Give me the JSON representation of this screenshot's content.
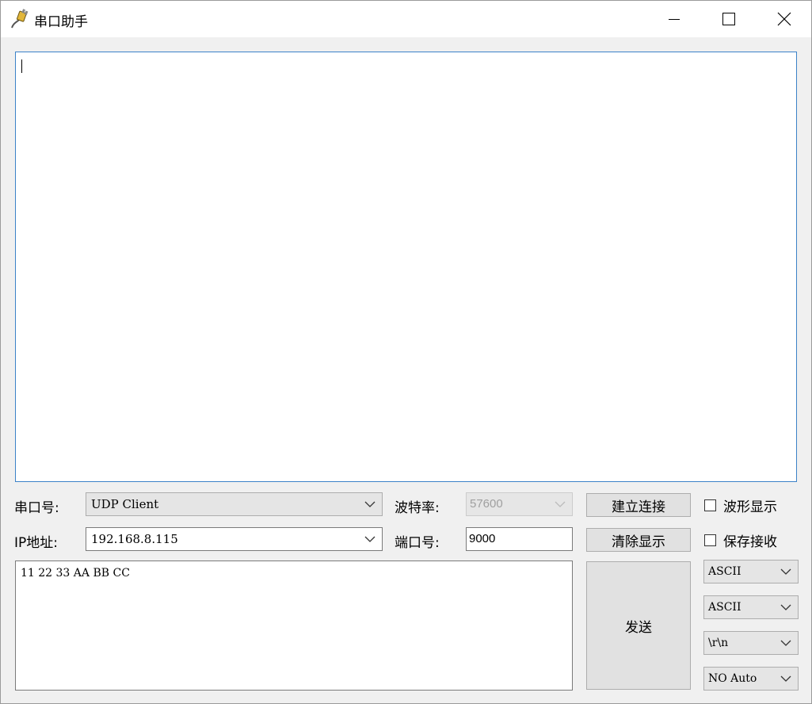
{
  "window": {
    "title": "串口助手"
  },
  "receive": {
    "content": ""
  },
  "settings": {
    "port_label": "串口号:",
    "port_value": "UDP Client",
    "baud_label": "波特率:",
    "baud_value": "57600",
    "ip_label": "IP地址:",
    "ip_value": "192.168.8.115",
    "netport_label": "端口号:",
    "netport_value": "9000"
  },
  "buttons": {
    "connect": "建立连接",
    "clear": "清除显示",
    "send": "发送"
  },
  "checkboxes": {
    "waveform": {
      "label": "波形显示",
      "checked": false
    },
    "save_receive": {
      "label": "保存接收",
      "checked": false
    }
  },
  "send": {
    "content": "11 22 33 AA BB CC"
  },
  "options": {
    "receive_format": "ASCII",
    "send_format": "ASCII",
    "line_ending": "\\r\\n",
    "auto_send": "NO Auto"
  },
  "icons": {
    "app": "serial-cable-icon",
    "minimize": "minimize-icon",
    "maximize": "maximize-icon",
    "close": "close-icon",
    "dropdown": "chevron-down-icon"
  }
}
